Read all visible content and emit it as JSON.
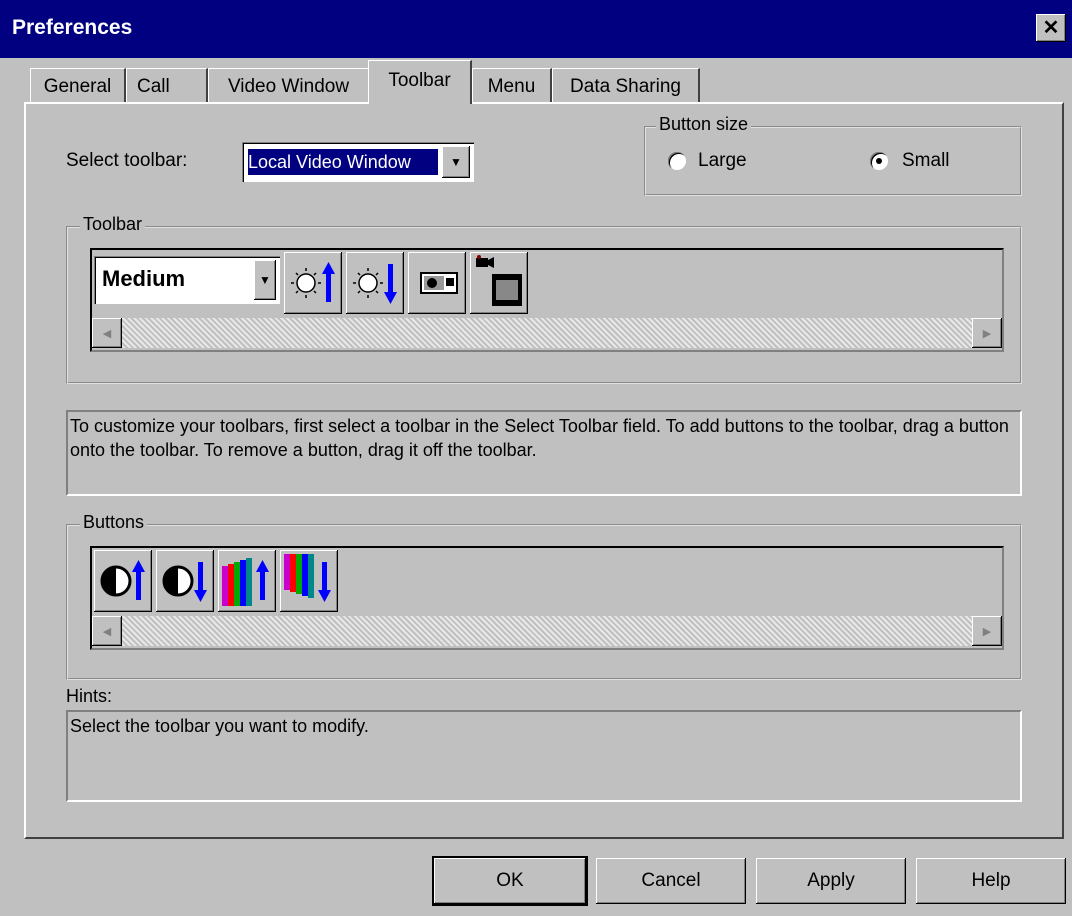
{
  "window": {
    "title": "Preferences",
    "close_glyph": "✕"
  },
  "tabs": [
    {
      "label": "General"
    },
    {
      "label": "Call"
    },
    {
      "label": "Video Window"
    },
    {
      "label": "Toolbar"
    },
    {
      "label": "Menu"
    },
    {
      "label": "Data Sharing"
    }
  ],
  "active_tab": "Toolbar",
  "select_toolbar": {
    "label": "Select toolbar:",
    "value": "Local Video Window"
  },
  "button_size": {
    "legend": "Button size",
    "options": [
      {
        "label": "Large",
        "selected": false
      },
      {
        "label": "Small",
        "selected": true
      }
    ]
  },
  "toolbar_group": {
    "legend": "Toolbar",
    "size_combo_value": "Medium",
    "buttons": [
      "brightness-up-icon",
      "brightness-down-icon",
      "snapshot-camera-icon",
      "video-capture-icon"
    ]
  },
  "description": "To customize your toolbars, first select a toolbar in the Select Toolbar field. To add buttons to the toolbar, drag a button onto the toolbar. To remove a button, drag it off the toolbar.",
  "buttons_group": {
    "legend": "Buttons",
    "buttons": [
      "contrast-up-icon",
      "contrast-down-icon",
      "color-up-icon",
      "color-down-icon"
    ]
  },
  "hints": {
    "label": "Hints:",
    "text": "Select the toolbar you want to modify."
  },
  "dialog_buttons": {
    "ok": "OK",
    "cancel": "Cancel",
    "apply": "Apply",
    "help": "Help"
  },
  "colors": {
    "titlebar": "#000080",
    "face": "#c0c0c0",
    "arrow": "#0000ff"
  }
}
